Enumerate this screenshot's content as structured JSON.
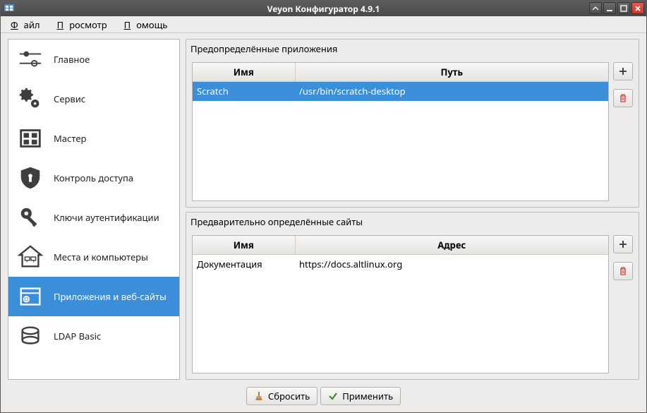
{
  "window": {
    "title": "Veyon Конфигуратор 4.9.1"
  },
  "menubar": {
    "file": "Файл",
    "view": "Просмотр",
    "help": "Помощь"
  },
  "sidebar": {
    "items": [
      {
        "label": "Главное"
      },
      {
        "label": "Сервис"
      },
      {
        "label": "Мастер"
      },
      {
        "label": "Контроль доступа"
      },
      {
        "label": "Ключи аутентификации"
      },
      {
        "label": "Места и компьютеры"
      },
      {
        "label": "Приложения и веб-сайты"
      },
      {
        "label": "LDAP Basic"
      }
    ]
  },
  "apps_group": {
    "title": "Предопределённые приложения",
    "headers": {
      "name": "Имя",
      "path": "Путь"
    },
    "rows": [
      {
        "name": "Scratch",
        "path": "/usr/bin/scratch-desktop"
      }
    ]
  },
  "sites_group": {
    "title": "Предварительно определённые сайты",
    "headers": {
      "name": "Имя",
      "address": "Адрес"
    },
    "rows": [
      {
        "name": "Документация",
        "address": "https://docs.altlinux.org"
      }
    ]
  },
  "buttons": {
    "reset": "Сбросить",
    "apply": "Применить"
  }
}
